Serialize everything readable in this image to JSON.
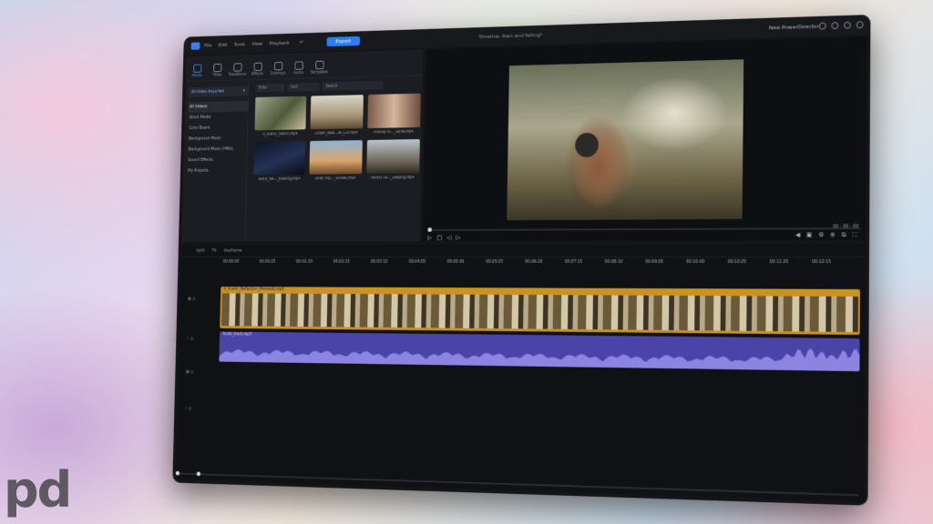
{
  "menubar": {
    "items": [
      "File",
      "Edit",
      "Tools",
      "View",
      "Playback"
    ],
    "export_label": "Export",
    "project_title": "Timeline: Rain and falling*",
    "app_name": "New PowerDirector"
  },
  "library": {
    "tools": [
      "Media",
      "Titles",
      "Transitions",
      "Effects",
      "Overlays",
      "Audio",
      "Templates"
    ],
    "import_label": "All Video Imported",
    "categories": [
      "All Videos",
      "Stock Media",
      "Color Board",
      "Background Music",
      "Background Music (HWs)",
      "Sound Effects",
      "My Projects"
    ],
    "search_buttons": [
      "Filter",
      "Sort",
      "Search"
    ],
    "clips": [
      {
        "name": "A_scenic_ribbon.mp4"
      },
      {
        "name": "Ocean_Beat...all_Cut.mp4"
      },
      {
        "name": "Friends Fo..._Selfie.mp4"
      },
      {
        "name": "Rainy_Ne..._Evening.mp4"
      },
      {
        "name": "Road Trip..._Sunset.mp4"
      },
      {
        "name": "Person Le..._Leaping.mp4"
      }
    ]
  },
  "preview": {
    "timecode": "00 : 00 : 00"
  },
  "timeline": {
    "tool_labels": [
      "Split",
      "Fit",
      "Keyframe"
    ],
    "ruler": [
      "00:00:00",
      "00:00:25",
      "00:01:20",
      "00:02:15",
      "00:03:10",
      "00:04:05",
      "00:05:00",
      "00:05:25",
      "00:06:20",
      "00:07:15",
      "00:08:10",
      "00:09:05",
      "00:10:00",
      "00:10:25",
      "00:11:20",
      "00:12:15"
    ],
    "video_clip_label": "A_Scenic_Reflection_Moments.mp4",
    "audio_clip_label": "Audio_track.mp3"
  },
  "watermark": "pd"
}
